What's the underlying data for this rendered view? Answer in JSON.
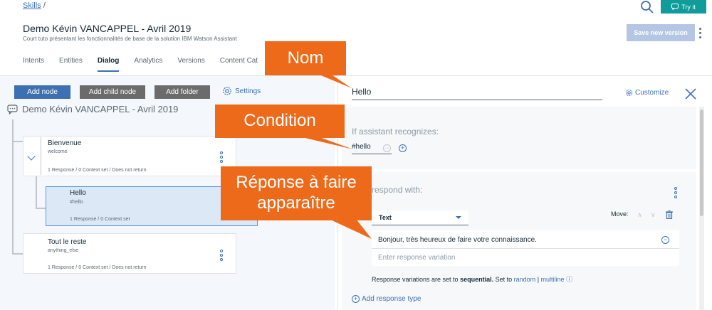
{
  "header": {
    "breadcrumb_link": "Skills",
    "breadcrumb_sep": "/",
    "title": "Demo Kévin VANCAPPEL - Avril 2019",
    "description": "Court tuto présentant les fonctionnalités de base de la solution IBM Watson Assistant",
    "try_it_label": "Try it",
    "save_version_label": "Save new version",
    "tabs": [
      {
        "label": "Intents",
        "active": false
      },
      {
        "label": "Entities",
        "active": false
      },
      {
        "label": "Dialog",
        "active": true
      },
      {
        "label": "Analytics",
        "active": false
      },
      {
        "label": "Versions",
        "active": false
      },
      {
        "label": "Content Cat",
        "active": false
      }
    ]
  },
  "tree": {
    "add_node_label": "Add node",
    "add_child_node_label": "Add child node",
    "add_folder_label": "Add folder",
    "settings_label": "Settings",
    "skill_title": "Demo Kévin VANCAPPEL - Avril 2019",
    "nodes": [
      {
        "title": "Bienvenue",
        "condition": "welcome",
        "meta": "1 Response / 0 Context set / Does not return"
      },
      {
        "title": "Hello",
        "condition": "#hello",
        "meta": "1 Response / 0 Context set"
      },
      {
        "title": "Tout le reste",
        "condition": "anything_else",
        "meta": "1 Response / 0 Context set / Does not return"
      }
    ]
  },
  "editor": {
    "node_name": "Hello",
    "customize_label": "Customize",
    "if_label": "If assistant recognizes:",
    "condition_value": "#hello",
    "respond_label": "respond with:",
    "response_type": "Text",
    "move_label": "Move:",
    "response_text": "Bonjour, très heureux de faire votre connaissance.",
    "response_placeholder": "Enter response variation",
    "variation_note_prefix": "Response variations are set to",
    "variation_mode": "sequential.",
    "variation_set_to": "Set to",
    "variation_random": "random",
    "variation_sep": "|",
    "variation_multiline": "multiline",
    "add_response_type_label": "Add response type"
  },
  "callouts": {
    "nom": "Nom",
    "condition": "Condition",
    "reponse_line1": "Réponse à faire",
    "reponse_line2": "apparaître"
  },
  "colors": {
    "accent": "#3d70b2",
    "callout": "#ee6a1b",
    "try_it": "#0f9c9b",
    "save_disabled": "#b4c6e3"
  }
}
